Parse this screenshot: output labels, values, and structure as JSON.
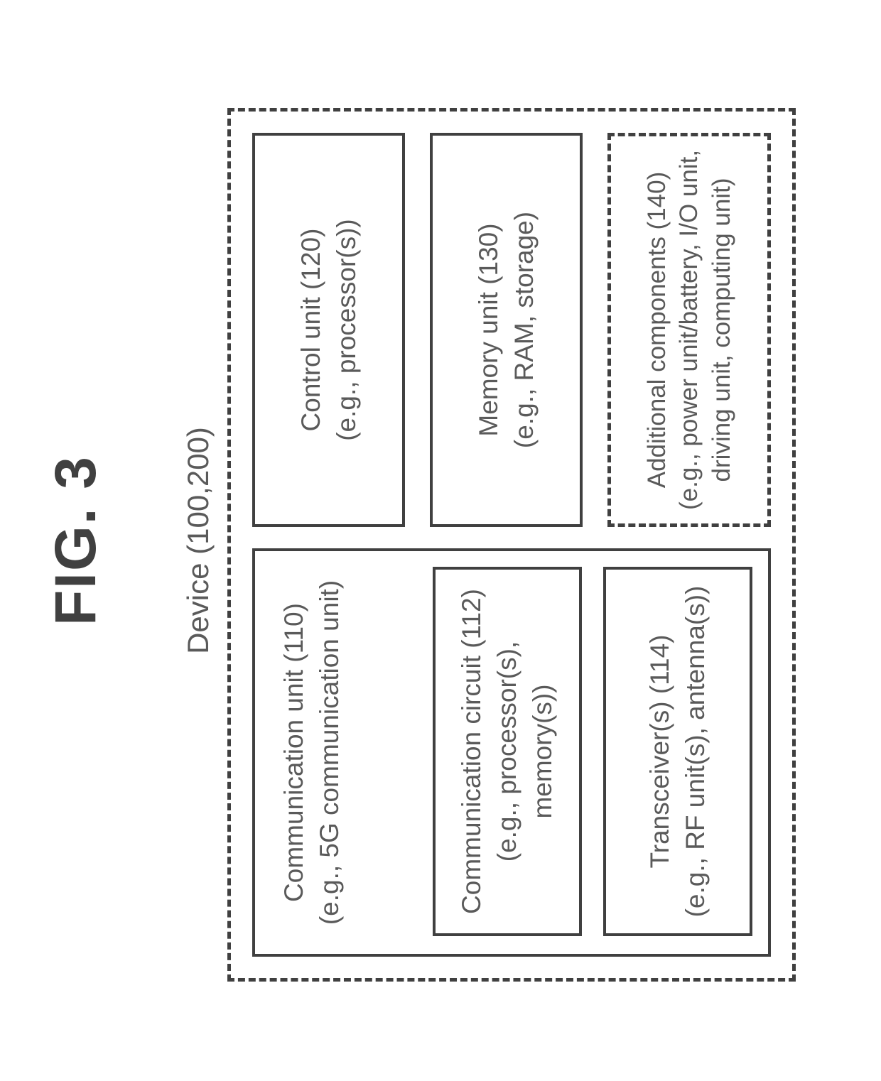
{
  "figure": {
    "title": "FIG. 3",
    "device_label": "Device (100,200)"
  },
  "blocks": {
    "comm_unit": {
      "line1": "Communication unit (110)",
      "line2": "(e.g., 5G communication unit)"
    },
    "comm_circuit": {
      "line1": "Communication circuit (112)",
      "line2": "(e.g., processor(s), memory(s))"
    },
    "transceiver": {
      "line1": "Transceiver(s) (114)",
      "line2": "(e.g., RF unit(s), antenna(s))"
    },
    "control_unit": {
      "line1": "Control unit (120)",
      "line2": "(e.g., processor(s))"
    },
    "memory_unit": {
      "line1": "Memory unit (130)",
      "line2": "(e.g., RAM, storage)"
    },
    "additional": {
      "line1": "Additional components (140)",
      "line2": "(e.g., power unit/battery, I/O unit,",
      "line3": "driving unit, computing unit)"
    }
  }
}
